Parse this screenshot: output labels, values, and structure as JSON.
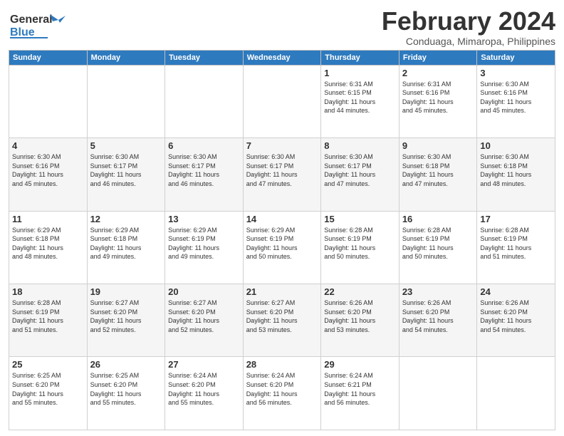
{
  "header": {
    "logo_general": "General",
    "logo_blue": "Blue",
    "title": "February 2024",
    "subtitle": "Conduaga, Mimaropa, Philippines"
  },
  "weekdays": [
    "Sunday",
    "Monday",
    "Tuesday",
    "Wednesday",
    "Thursday",
    "Friday",
    "Saturday"
  ],
  "weeks": [
    [
      {
        "day": "",
        "info": ""
      },
      {
        "day": "",
        "info": ""
      },
      {
        "day": "",
        "info": ""
      },
      {
        "day": "",
        "info": ""
      },
      {
        "day": "1",
        "info": "Sunrise: 6:31 AM\nSunset: 6:15 PM\nDaylight: 11 hours\nand 44 minutes."
      },
      {
        "day": "2",
        "info": "Sunrise: 6:31 AM\nSunset: 6:16 PM\nDaylight: 11 hours\nand 45 minutes."
      },
      {
        "day": "3",
        "info": "Sunrise: 6:30 AM\nSunset: 6:16 PM\nDaylight: 11 hours\nand 45 minutes."
      }
    ],
    [
      {
        "day": "4",
        "info": "Sunrise: 6:30 AM\nSunset: 6:16 PM\nDaylight: 11 hours\nand 45 minutes."
      },
      {
        "day": "5",
        "info": "Sunrise: 6:30 AM\nSunset: 6:17 PM\nDaylight: 11 hours\nand 46 minutes."
      },
      {
        "day": "6",
        "info": "Sunrise: 6:30 AM\nSunset: 6:17 PM\nDaylight: 11 hours\nand 46 minutes."
      },
      {
        "day": "7",
        "info": "Sunrise: 6:30 AM\nSunset: 6:17 PM\nDaylight: 11 hours\nand 47 minutes."
      },
      {
        "day": "8",
        "info": "Sunrise: 6:30 AM\nSunset: 6:17 PM\nDaylight: 11 hours\nand 47 minutes."
      },
      {
        "day": "9",
        "info": "Sunrise: 6:30 AM\nSunset: 6:18 PM\nDaylight: 11 hours\nand 47 minutes."
      },
      {
        "day": "10",
        "info": "Sunrise: 6:30 AM\nSunset: 6:18 PM\nDaylight: 11 hours\nand 48 minutes."
      }
    ],
    [
      {
        "day": "11",
        "info": "Sunrise: 6:29 AM\nSunset: 6:18 PM\nDaylight: 11 hours\nand 48 minutes."
      },
      {
        "day": "12",
        "info": "Sunrise: 6:29 AM\nSunset: 6:18 PM\nDaylight: 11 hours\nand 49 minutes."
      },
      {
        "day": "13",
        "info": "Sunrise: 6:29 AM\nSunset: 6:19 PM\nDaylight: 11 hours\nand 49 minutes."
      },
      {
        "day": "14",
        "info": "Sunrise: 6:29 AM\nSunset: 6:19 PM\nDaylight: 11 hours\nand 50 minutes."
      },
      {
        "day": "15",
        "info": "Sunrise: 6:28 AM\nSunset: 6:19 PM\nDaylight: 11 hours\nand 50 minutes."
      },
      {
        "day": "16",
        "info": "Sunrise: 6:28 AM\nSunset: 6:19 PM\nDaylight: 11 hours\nand 50 minutes."
      },
      {
        "day": "17",
        "info": "Sunrise: 6:28 AM\nSunset: 6:19 PM\nDaylight: 11 hours\nand 51 minutes."
      }
    ],
    [
      {
        "day": "18",
        "info": "Sunrise: 6:28 AM\nSunset: 6:19 PM\nDaylight: 11 hours\nand 51 minutes."
      },
      {
        "day": "19",
        "info": "Sunrise: 6:27 AM\nSunset: 6:20 PM\nDaylight: 11 hours\nand 52 minutes."
      },
      {
        "day": "20",
        "info": "Sunrise: 6:27 AM\nSunset: 6:20 PM\nDaylight: 11 hours\nand 52 minutes."
      },
      {
        "day": "21",
        "info": "Sunrise: 6:27 AM\nSunset: 6:20 PM\nDaylight: 11 hours\nand 53 minutes."
      },
      {
        "day": "22",
        "info": "Sunrise: 6:26 AM\nSunset: 6:20 PM\nDaylight: 11 hours\nand 53 minutes."
      },
      {
        "day": "23",
        "info": "Sunrise: 6:26 AM\nSunset: 6:20 PM\nDaylight: 11 hours\nand 54 minutes."
      },
      {
        "day": "24",
        "info": "Sunrise: 6:26 AM\nSunset: 6:20 PM\nDaylight: 11 hours\nand 54 minutes."
      }
    ],
    [
      {
        "day": "25",
        "info": "Sunrise: 6:25 AM\nSunset: 6:20 PM\nDaylight: 11 hours\nand 55 minutes."
      },
      {
        "day": "26",
        "info": "Sunrise: 6:25 AM\nSunset: 6:20 PM\nDaylight: 11 hours\nand 55 minutes."
      },
      {
        "day": "27",
        "info": "Sunrise: 6:24 AM\nSunset: 6:20 PM\nDaylight: 11 hours\nand 55 minutes."
      },
      {
        "day": "28",
        "info": "Sunrise: 6:24 AM\nSunset: 6:20 PM\nDaylight: 11 hours\nand 56 minutes."
      },
      {
        "day": "29",
        "info": "Sunrise: 6:24 AM\nSunset: 6:21 PM\nDaylight: 11 hours\nand 56 minutes."
      },
      {
        "day": "",
        "info": ""
      },
      {
        "day": "",
        "info": ""
      }
    ]
  ]
}
